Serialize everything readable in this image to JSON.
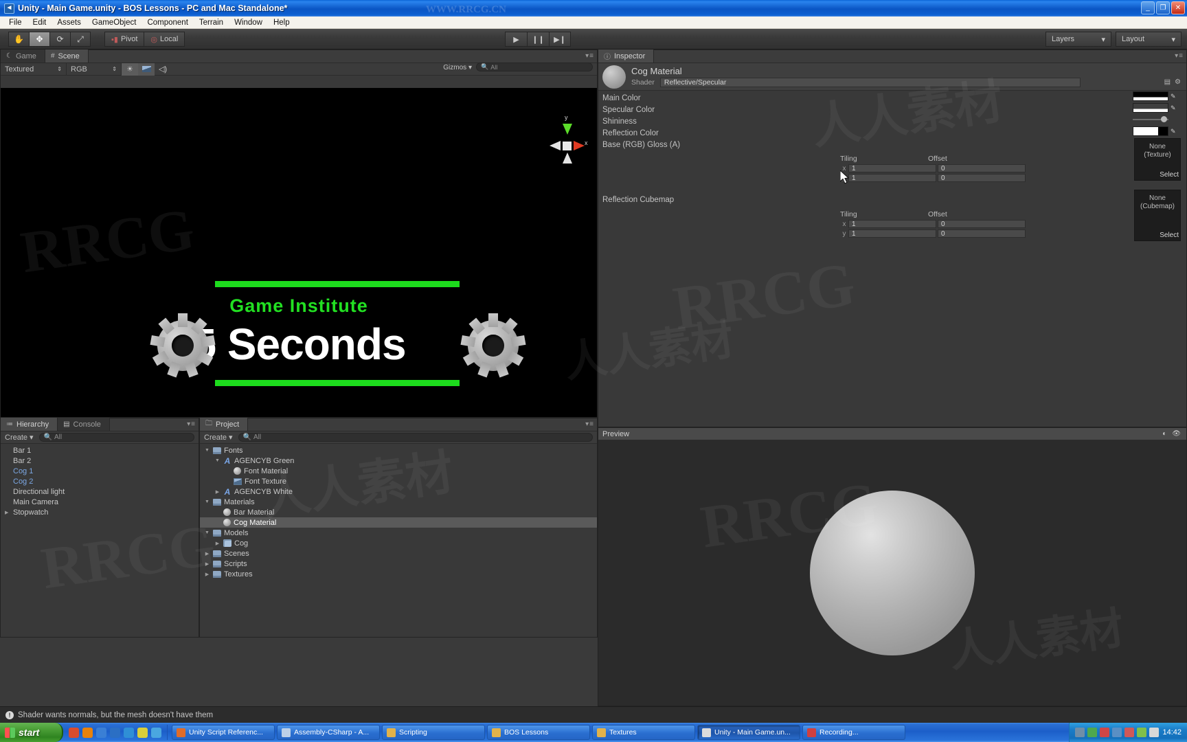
{
  "window": {
    "title": "Unity - Main Game.unity - BOS Lessons - PC and Mac Standalone*",
    "icon": "unity-icon",
    "minimize": "_",
    "maximize": "❐",
    "close": "✕"
  },
  "menubar": {
    "items": [
      "File",
      "Edit",
      "Assets",
      "GameObject",
      "Component",
      "Terrain",
      "Window",
      "Help"
    ]
  },
  "toolbar": {
    "tools": [
      {
        "name": "hand-tool",
        "glyph": "✋"
      },
      {
        "name": "move-tool",
        "glyph": "✥"
      },
      {
        "name": "rotate-tool",
        "glyph": "⟳"
      },
      {
        "name": "scale-tool",
        "glyph": "⤢"
      }
    ],
    "pivot_label": "Pivot",
    "local_label": "Local",
    "play": "▶",
    "pause": "❙❙",
    "step": "▶❙",
    "layers_label": "Layers",
    "layout_label": "Layout",
    "dropdown_arrow": "▾"
  },
  "scene": {
    "tabs": [
      {
        "label": "Game",
        "icon": "game-icon",
        "selected": false
      },
      {
        "label": "Scene",
        "icon": "scene-grid-icon",
        "selected": true
      }
    ],
    "draw_mode": "Textured",
    "color_mode": "RGB",
    "light_icon": "☀",
    "fx_icon": "🖼",
    "audio_icon": "◁)",
    "gizmos_label": "Gizmos",
    "search_placeholder": "All",
    "axis_labels": {
      "y": "y",
      "x": "x"
    },
    "art": {
      "title_green": "Game Institute",
      "title_white": "5 Seconds",
      "bar_color": "#1ddc1d",
      "background": "#000000"
    }
  },
  "hierarchy": {
    "tab_label": "Hierarchy",
    "console_tab_label": "Console",
    "create_label": "Create",
    "create_arrow": "▾",
    "search_placeholder": "All",
    "items": [
      {
        "label": "Bar 1",
        "expandable": false,
        "prefab": false
      },
      {
        "label": "Bar 2",
        "expandable": false,
        "prefab": false
      },
      {
        "label": "Cog 1",
        "expandable": false,
        "prefab": true
      },
      {
        "label": "Cog 2",
        "expandable": false,
        "prefab": true
      },
      {
        "label": "Directional light",
        "expandable": false,
        "prefab": false
      },
      {
        "label": "Main Camera",
        "expandable": false,
        "prefab": false
      },
      {
        "label": "Stopwatch",
        "expandable": true,
        "prefab": false
      }
    ]
  },
  "project": {
    "tab_label": "Project",
    "create_label": "Create",
    "create_arrow": "▾",
    "search_placeholder": "All",
    "items": [
      {
        "label": "Fonts",
        "indent": 0,
        "icon": "folder",
        "arrow": "▾",
        "selected": false
      },
      {
        "label": "AGENCYB Green",
        "indent": 1,
        "icon": "font",
        "arrow": "▾",
        "selected": false
      },
      {
        "label": "Font Material",
        "indent": 2,
        "icon": "material",
        "arrow": "",
        "selected": false
      },
      {
        "label": "Font Texture",
        "indent": 2,
        "icon": "texture",
        "arrow": "",
        "selected": false
      },
      {
        "label": "AGENCYB White",
        "indent": 1,
        "icon": "font",
        "arrow": "▸",
        "selected": false
      },
      {
        "label": "Materials",
        "indent": 0,
        "icon": "folder",
        "arrow": "▾",
        "selected": false
      },
      {
        "label": "Bar Material",
        "indent": 1,
        "icon": "material",
        "arrow": "",
        "selected": false
      },
      {
        "label": "Cog Material",
        "indent": 1,
        "icon": "material",
        "arrow": "",
        "selected": true
      },
      {
        "label": "Models",
        "indent": 0,
        "icon": "folder",
        "arrow": "▾",
        "selected": false
      },
      {
        "label": "Cog",
        "indent": 1,
        "icon": "mesh",
        "arrow": "▸",
        "selected": false
      },
      {
        "label": "Scenes",
        "indent": 0,
        "icon": "folder",
        "arrow": "▸",
        "selected": false
      },
      {
        "label": "Scripts",
        "indent": 0,
        "icon": "folder",
        "arrow": "▸",
        "selected": false
      },
      {
        "label": "Textures",
        "indent": 0,
        "icon": "folder",
        "arrow": "▸",
        "selected": false
      }
    ]
  },
  "inspector": {
    "tab_label": "Inspector",
    "tab_icon": "info-icon",
    "material_name": "Cog Material",
    "shader_label": "Shader",
    "shader_value": "Reflective/Specular",
    "properties": [
      "Main Color",
      "Specular Color",
      "Shininess",
      "Reflection Color",
      "Base (RGB) Gloss (A)"
    ],
    "reflection_cubemap_label": "Reflection Cubemap",
    "tiling_label": "Tiling",
    "offset_label": "Offset",
    "axis_x": "x",
    "axis_y": "y",
    "base_texture": {
      "tiling_x": "1",
      "tiling_y": "1",
      "offset_x": "0",
      "offset_y": "0",
      "slot_line1": "None",
      "slot_line2": "(Texture)",
      "select_label": "Select"
    },
    "cubemap_texture": {
      "tiling_x": "1",
      "tiling_y": "1",
      "offset_x": "0",
      "offset_y": "0",
      "slot_line1": "None",
      "slot_line2": "(Cubemap)",
      "select_label": "Select"
    },
    "colors": {
      "main_color": "#000000",
      "specular_color": "#3f3f3f",
      "reflection_color": "#ffffff"
    }
  },
  "preview": {
    "title": "Preview",
    "tool_icons": [
      "lighting-icon",
      "eye-icon"
    ]
  },
  "status": {
    "icon": "warning-icon",
    "message": "Shader wants normals, but the mesh  doesn't have them"
  },
  "taskbar": {
    "start_label": "start",
    "quicklaunch": [
      {
        "name": "browser-icon",
        "color": "#d94c2e"
      },
      {
        "name": "vlc-icon",
        "color": "#e8820c"
      },
      {
        "name": "ie-icon",
        "color": "#3a7fd5"
      },
      {
        "name": "media-icon",
        "color": "#2b6fc4"
      },
      {
        "name": "globe-icon",
        "color": "#2f8fd6"
      },
      {
        "name": "bulb-icon",
        "color": "#d9cf3a"
      },
      {
        "name": "disc-icon",
        "color": "#4aa7e0"
      }
    ],
    "tasks": [
      {
        "label": "Unity Script Referenc...",
        "icon": "firefox-icon",
        "active": false
      },
      {
        "label": "Assembly-CSharp - A...",
        "icon": "mono-icon",
        "active": false
      },
      {
        "label": "Scripting",
        "icon": "folder-icon",
        "active": false
      },
      {
        "label": "BOS Lessons",
        "icon": "folder-icon",
        "active": false
      },
      {
        "label": "Textures",
        "icon": "folder-icon",
        "active": false
      },
      {
        "label": "Unity - Main Game.un...",
        "icon": "unity-icon",
        "active": true
      },
      {
        "label": "Recording...",
        "icon": "record-icon",
        "active": false
      }
    ],
    "tray_icons": [
      {
        "name": "network-icon",
        "color": "#6f8ea8"
      },
      {
        "name": "shield-icon",
        "color": "#4ea84e"
      },
      {
        "name": "antivirus-icon",
        "color": "#cf4646"
      },
      {
        "name": "sync-icon",
        "color": "#5a8fc4"
      },
      {
        "name": "warn-icon",
        "color": "#d05858"
      },
      {
        "name": "app-icon",
        "color": "#7fc04a"
      },
      {
        "name": "volume-icon",
        "color": "#d8d8d8"
      }
    ],
    "clock": "14:42"
  },
  "watermarks": {
    "domain": "WWW.RRCG.CN",
    "brand": "RRCG",
    "cn": "人人素材"
  }
}
